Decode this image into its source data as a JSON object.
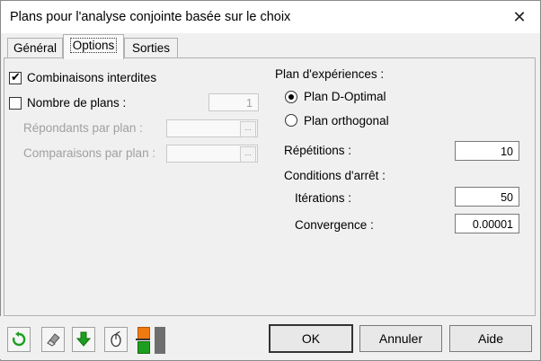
{
  "window": {
    "title": "Plans pour l'analyse conjointe basée sur le choix",
    "close_glyph": "✕"
  },
  "tabs": [
    {
      "label": "Général"
    },
    {
      "label": "Options"
    },
    {
      "label": "Sorties"
    }
  ],
  "options": {
    "forbidden_combinations": {
      "label": "Combinaisons interdites",
      "checked": true,
      "mark": "✔"
    },
    "num_plans": {
      "label": "Nombre de plans :",
      "checked": false,
      "value": "1"
    },
    "respondents": {
      "label": "Répondants par plan :",
      "dd_glyph": "..."
    },
    "comparisons": {
      "label": "Comparaisons par plan :",
      "dd_glyph": "..."
    }
  },
  "design": {
    "heading": "Plan d'expériences :",
    "d_optimal": {
      "label": "Plan D-Optimal",
      "selected": true
    },
    "orthogonal": {
      "label": "Plan orthogonal",
      "selected": false
    },
    "repetitions": {
      "label": "Répétitions :",
      "value": "10"
    },
    "stop_conditions": {
      "heading": "Conditions d'arrêt :",
      "iterations": {
        "label": "Itérations :",
        "value": "50"
      },
      "convergence": {
        "label": "Convergence :",
        "value": "0.00001"
      }
    }
  },
  "toolbar_icons": [
    "reset-icon",
    "eraser-icon",
    "download-arrow-icon",
    "mouse-icon",
    "color-swatch-icon"
  ],
  "buttons": {
    "ok": "OK",
    "cancel": "Annuler",
    "help": "Aide"
  },
  "colors": {
    "green": "#1e9e1e",
    "orange": "#f07a10",
    "dark_gray": "#6e6e6e"
  }
}
